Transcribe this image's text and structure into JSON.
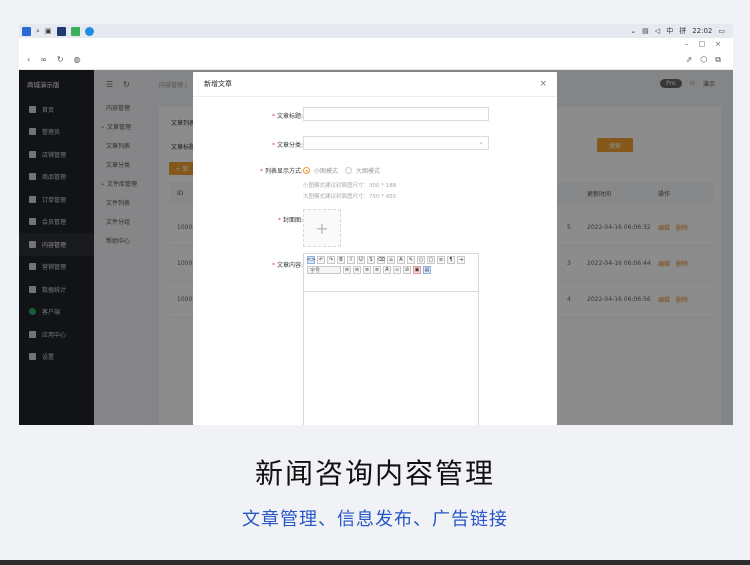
{
  "taskbar": {
    "time": "22:02",
    "ime": "中",
    "badge": "拼"
  },
  "window_controls": [
    "–",
    "□",
    "×"
  ],
  "sidebar": {
    "brand": "商城演示版",
    "items": [
      {
        "label": "首页",
        "icon": "home-icon"
      },
      {
        "label": "管理员",
        "icon": "admin-icon"
      },
      {
        "label": "店铺管理",
        "icon": "store-icon"
      },
      {
        "label": "商品管理",
        "icon": "goods-icon"
      },
      {
        "label": "订单管理",
        "icon": "order-icon"
      },
      {
        "label": "会员管理",
        "icon": "member-icon"
      },
      {
        "label": "内容管理",
        "icon": "content-icon"
      },
      {
        "label": "营销管理",
        "icon": "marketing-icon"
      },
      {
        "label": "数据统计",
        "icon": "chart-icon"
      },
      {
        "label": "客户端",
        "icon": "client-icon"
      },
      {
        "label": "应用中心",
        "icon": "apps-icon"
      },
      {
        "label": "设置",
        "icon": "settings-icon"
      }
    ]
  },
  "subnav": {
    "items": [
      "内容管理",
      "文章管理",
      "文章列表",
      "文章分类",
      "文件库管理",
      "文件列表",
      "文件分组",
      "帮助中心"
    ]
  },
  "header": {
    "breadcrumb": "内容管理 /",
    "pill": "Pro",
    "user": "演示"
  },
  "panel": {
    "list_title": "文章列表",
    "search_label": "文章标题",
    "add_label": "+ 新",
    "search_button": "搜索",
    "columns": [
      "ID",
      "更新时间",
      "操作"
    ],
    "rows": [
      {
        "id": "10004",
        "tail": "5",
        "updated": "2022-04-16 06:06:32"
      },
      {
        "id": "10003",
        "tail": "3",
        "updated": "2022-04-16 06:06:44"
      },
      {
        "id": "10002",
        "tail": "4",
        "updated": "2022-04-16 06:06:56"
      }
    ],
    "edit": "编辑",
    "delete": "删除"
  },
  "modal": {
    "title": "新增文章",
    "close": "×",
    "title_label": "文章标题:",
    "category_label": "文章分类:",
    "display_label": "列表显示方式:",
    "radio_small": "小图模式",
    "radio_large": "大图模式",
    "hint_small": "小图模式建议封面图尺寸：300 * 188",
    "hint_large": "大图模式建议封面图尺寸：750 * 455",
    "cover_label": "封面图:",
    "content_label": "文章内容:",
    "font_size_placeholder": "字号"
  },
  "footer": {
    "title": "新闻咨询内容管理",
    "subtitle": "文章管理、信息发布、广告链接"
  },
  "colors": {
    "accent": "#f0a030",
    "sidebar_bg": "#1f2329",
    "subtitle": "#2756c6"
  }
}
